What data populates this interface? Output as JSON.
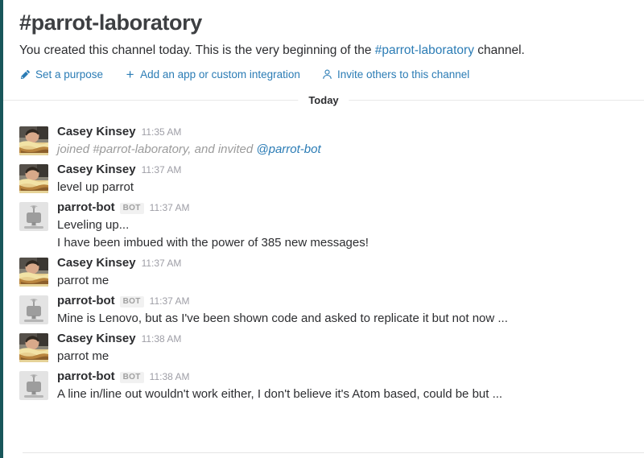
{
  "channel": {
    "title": "#parrot-laboratory",
    "description_before": "You created this channel today. This is the very beginning of the ",
    "description_link": "#parrot-laboratory",
    "description_after": " channel.",
    "actions": [
      {
        "icon": "pencil-icon",
        "label": "Set a purpose"
      },
      {
        "icon": "plus-icon",
        "label": "Add an app or custom integration"
      },
      {
        "icon": "person-icon",
        "label": "Invite others to this channel"
      }
    ]
  },
  "day_divider": {
    "label": "Today"
  },
  "messages": [
    {
      "author": "Casey Kinsey",
      "avatar": "user-photo-avatar",
      "is_bot": false,
      "bot_label": "",
      "timestamp": "11:35 AM",
      "system": true,
      "text_before": "joined #parrot-laboratory, and invited ",
      "mention": "@parrot-bot",
      "text_after": ""
    },
    {
      "author": "Casey Kinsey",
      "avatar": "user-photo-avatar",
      "is_bot": false,
      "bot_label": "",
      "timestamp": "11:37 AM",
      "system": false,
      "text": "level up parrot"
    },
    {
      "author": "parrot-bot",
      "avatar": "robot-avatar",
      "is_bot": true,
      "bot_label": "BOT",
      "timestamp": "11:37 AM",
      "system": false,
      "text": "Leveling up...",
      "extra_line": "I have been imbued with the power of 385 new messages!"
    },
    {
      "author": "Casey Kinsey",
      "avatar": "user-photo-avatar",
      "is_bot": false,
      "bot_label": "",
      "timestamp": "11:37 AM",
      "system": false,
      "text": "parrot me"
    },
    {
      "author": "parrot-bot",
      "avatar": "robot-avatar",
      "is_bot": true,
      "bot_label": "BOT",
      "timestamp": "11:37 AM",
      "system": false,
      "text": "Mine is Lenovo, but as I've been shown code and asked to replicate it but not now ..."
    },
    {
      "author": "Casey Kinsey",
      "avatar": "user-photo-avatar",
      "is_bot": false,
      "bot_label": "",
      "timestamp": "11:38 AM",
      "system": false,
      "text": "parrot me"
    },
    {
      "author": "parrot-bot",
      "avatar": "robot-avatar",
      "is_bot": true,
      "bot_label": "BOT",
      "timestamp": "11:38 AM",
      "system": false,
      "text": "A line in/line out wouldn't work either, I don't believe it's Atom based, could be but ..."
    }
  ],
  "colors": {
    "link": "#2b7cb5",
    "edge_strip": "#18565a",
    "text": "#2c2d30",
    "muted": "#9e9ea6"
  }
}
